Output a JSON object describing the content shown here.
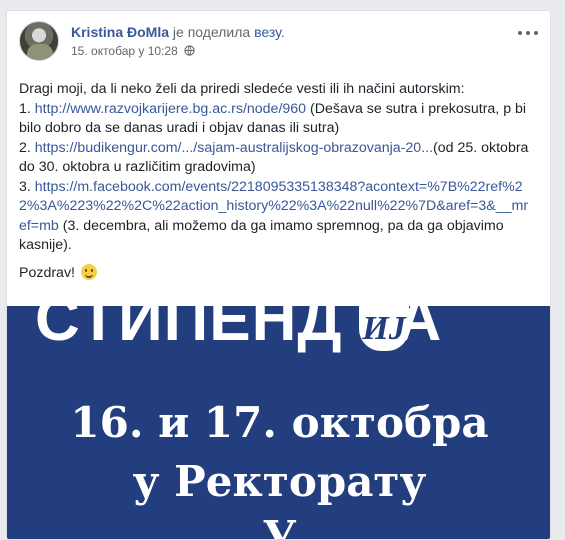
{
  "post": {
    "author": "Kristina ĐoMla",
    "shared_text": " је поделила ",
    "shared_link": "везу",
    "shared_period": ".",
    "timestamp": "15. октобар у 10:28",
    "privacy_icon": "globe-icon",
    "more_icon": "more-options-icon",
    "intro": "Dragi moji, da li neko želi da priredi sledeće vesti ili ih načini autorskim:",
    "items": [
      {
        "number": "1. ",
        "link": "http://www.razvojkarijere.bg.ac.rs/node/960",
        "note": " (Dešava se sutra i prekosutra, p bi bilo dobro da se danas uradi i objav danas ili sutra)"
      },
      {
        "number": "2. ",
        "link": "https://budikengur.com/.../sajam-australijskog-obrazovanja-20...",
        "note": "(od 25. oktobra do 30. oktobra u različitim gradovima)"
      },
      {
        "number": "3. ",
        "link": "https://m.facebook.com/events/2218095335138348?acontext=%7B%22ref%22%3A%223%22%2C%22action_history%22%3A%22null%22%7D&aref=3&__mref=mb",
        "note": " (3. decembra, ali možemo da ga imamo spremnog, pa da ga objavimo kasnije)."
      }
    ],
    "closing": "Pozdrav! ",
    "closing_emoji": "smile-emoji"
  },
  "banner": {
    "title": "СТИПЕНД",
    "title_ij": "ИЈ",
    "title_end": "А",
    "line1": "16. и 17. октобра",
    "line2": "у Ректорату",
    "line3": "У"
  },
  "colors": {
    "link": "#385898",
    "banner_bg": "#233e7e",
    "page_bg": "#e9ebee"
  }
}
